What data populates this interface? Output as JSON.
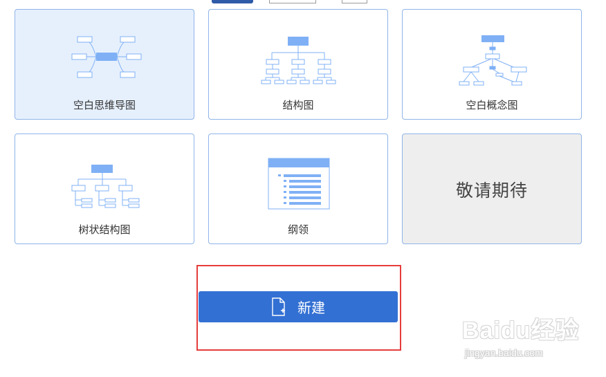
{
  "templates": [
    {
      "id": "blank-mindmap",
      "label": "空白思维导图",
      "selected": true
    },
    {
      "id": "structure",
      "label": "结构图",
      "selected": false
    },
    {
      "id": "blank-concept",
      "label": "空白概念图",
      "selected": false
    },
    {
      "id": "tree-structure",
      "label": "树状结构图",
      "selected": false
    },
    {
      "id": "outline",
      "label": "纲领",
      "selected": false
    },
    {
      "id": "coming-soon",
      "label": "敬请期待",
      "selected": false
    }
  ],
  "new_button": {
    "label": "新建",
    "icon": "new-file-icon"
  },
  "watermark": {
    "logo": "Baidu经验",
    "url": "jingyan.baidu.com"
  },
  "colors": {
    "accent": "#3370d3",
    "card_border": "#8fb4e8",
    "diagram_blue": "#7fb0f5",
    "selected_bg": "#e6f0fd",
    "soon_bg": "#eeeeee",
    "highlight": "#e63c3c"
  }
}
